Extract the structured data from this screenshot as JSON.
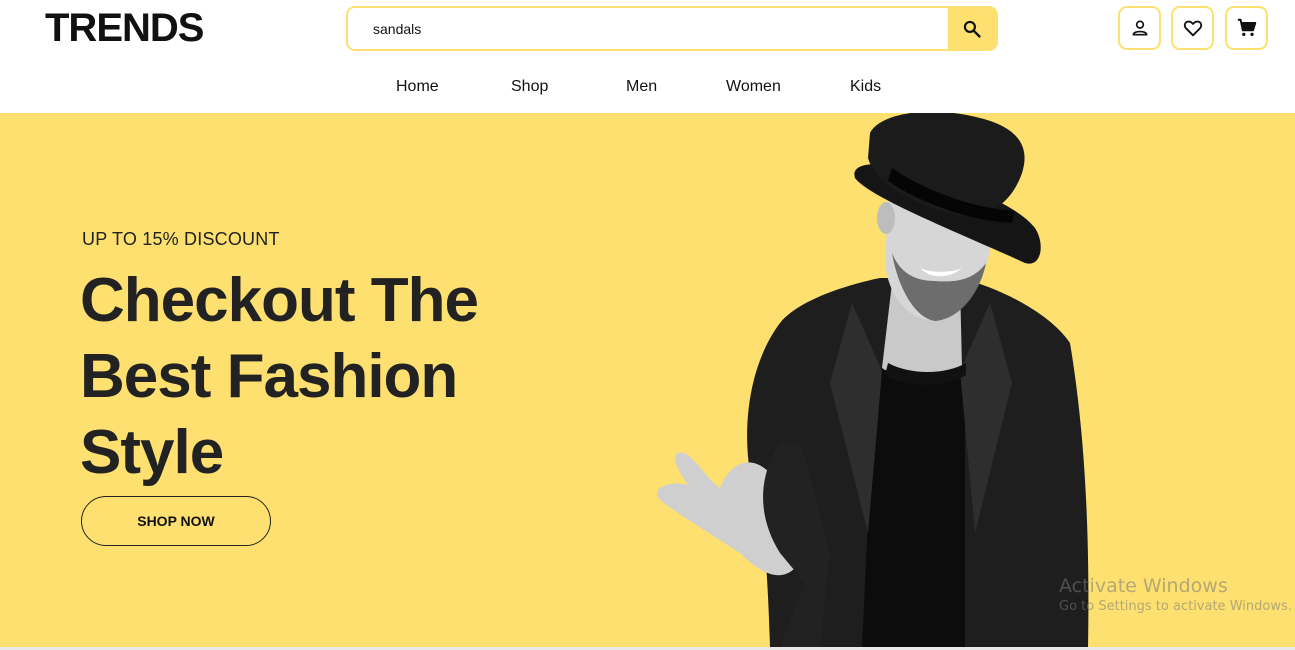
{
  "brand": {
    "logo": "TRENDS",
    "accent": "#fde06f",
    "text_dark": "#222222"
  },
  "search": {
    "value": "sandals",
    "icon": "search-icon"
  },
  "header_icons": [
    "user-icon",
    "heart-icon",
    "cart-icon"
  ],
  "nav": {
    "items": [
      {
        "label": "Home"
      },
      {
        "label": "Shop"
      },
      {
        "label": "Men"
      },
      {
        "label": "Women"
      },
      {
        "label": "Kids"
      }
    ]
  },
  "hero": {
    "eyebrow": "UP TO 15% DISCOUNT",
    "headline_lines": [
      "Checkout The",
      "Best Fashion",
      "Style"
    ],
    "cta": "SHOP NOW",
    "image": "man-in-black-hat-photo"
  },
  "os_watermark": {
    "title": "Activate Windows",
    "subtitle": "Go to Settings to activate Windows."
  }
}
